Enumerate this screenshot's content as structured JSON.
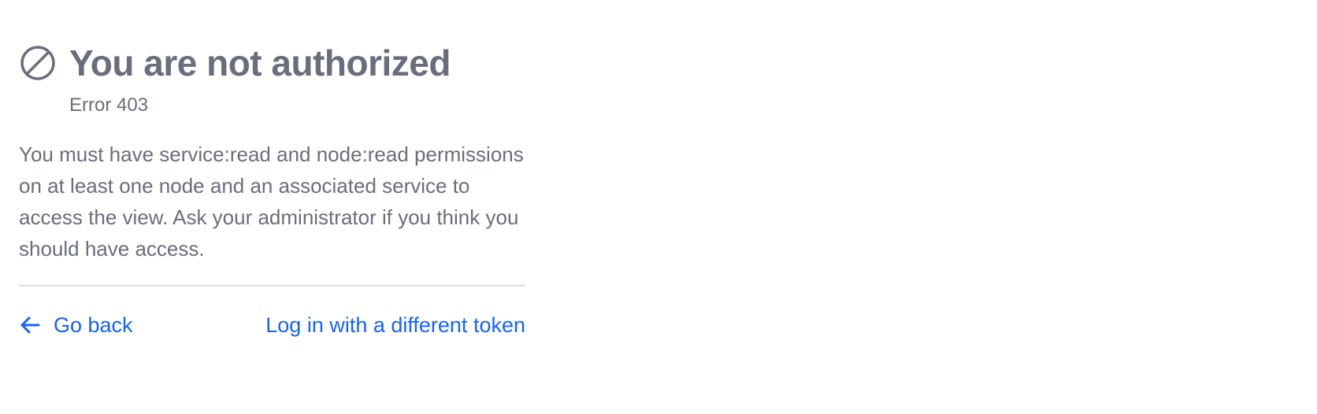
{
  "error": {
    "icon": "not-allowed-icon",
    "title": "You are not authorized",
    "code": "Error 403",
    "description": "You must have service:read and node:read permissions on at least one node and an associated service to access the view. Ask your administrator if you think you should have access."
  },
  "actions": {
    "back_icon": "arrow-left-icon",
    "back_label": "Go back",
    "token_label": "Log in with a different token"
  },
  "colors": {
    "text": "#6a6d7c",
    "link": "#1563ff",
    "divider": "#dcdce0"
  }
}
